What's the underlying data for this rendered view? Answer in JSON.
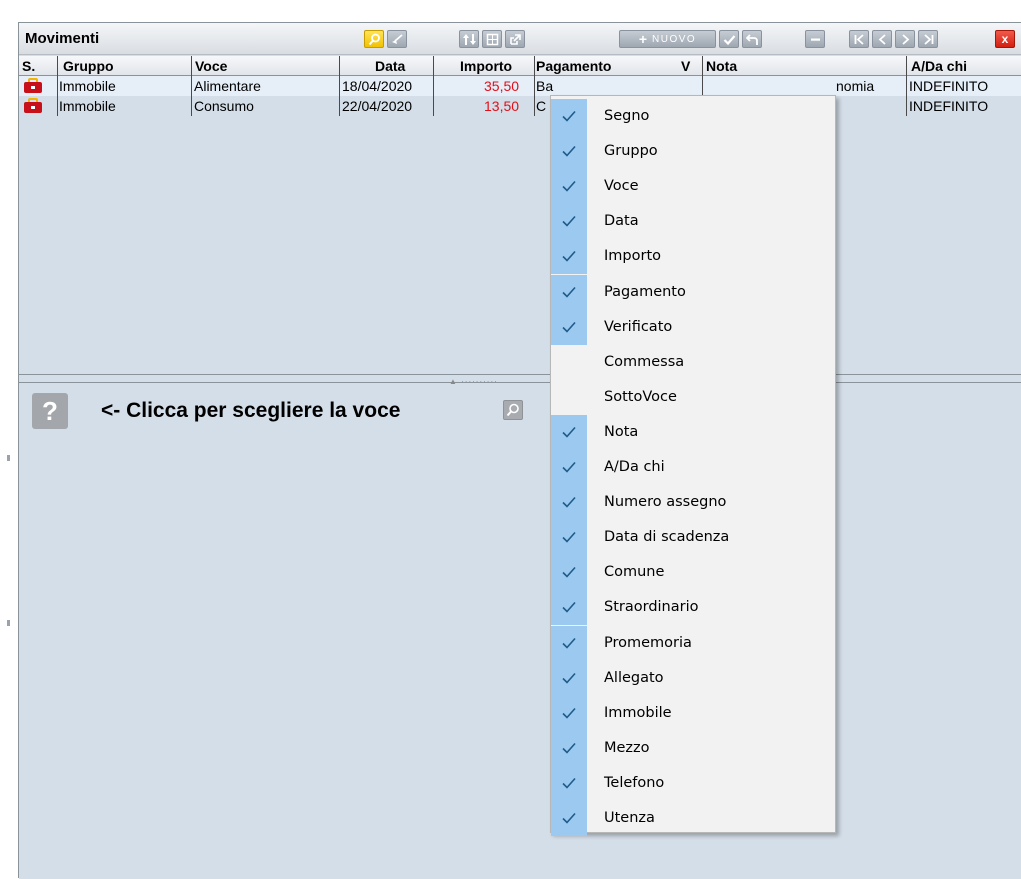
{
  "window": {
    "title": "Movimenti"
  },
  "toolbar": {
    "nuovo_label": "NUOVO",
    "close_label": "x"
  },
  "table": {
    "headers": [
      "S.",
      "Gruppo",
      "Voce",
      "Data",
      "Importo",
      "Pagamento",
      "V",
      "Nota",
      "A/Da chi"
    ],
    "rows": [
      {
        "icon": "red-briefcase-icon",
        "gruppo": "Immobile",
        "voce": "Alimentare",
        "data": "18/04/2020",
        "importo": "35,50",
        "pagamento": "Ba",
        "nota_end": "nomia",
        "a_da_chi": "INDEFINITO"
      },
      {
        "icon": "red-briefcase-icon",
        "gruppo": "Immobile",
        "voce": "Consumo",
        "data": "22/04/2020",
        "importo": "13,50",
        "pagamento": "C",
        "nota_end": "",
        "a_da_chi": "INDEFINITO"
      }
    ]
  },
  "lower": {
    "help_symbol": "?",
    "hint": "<- Clicca per scegliere la voce"
  },
  "context_menu": {
    "items": [
      {
        "label": "Segno",
        "checked": true
      },
      {
        "label": "Gruppo",
        "checked": true
      },
      {
        "label": "Voce",
        "checked": true
      },
      {
        "label": "Data",
        "checked": true
      },
      {
        "label": "Importo",
        "checked": true
      },
      {
        "label": "Pagamento",
        "checked": true
      },
      {
        "label": "Verificato",
        "checked": true
      },
      {
        "label": "Commessa",
        "checked": false
      },
      {
        "label": "SottoVoce",
        "checked": false
      },
      {
        "label": "Nota",
        "checked": true
      },
      {
        "label": "A/Da chi",
        "checked": true
      },
      {
        "label": "Numero assegno",
        "checked": true
      },
      {
        "label": "Data di scadenza",
        "checked": true
      },
      {
        "label": "Comune",
        "checked": true
      },
      {
        "label": "Straordinario",
        "checked": true
      },
      {
        "label": "Promemoria",
        "checked": true
      },
      {
        "label": "Allegato",
        "checked": true
      },
      {
        "label": "Immobile",
        "checked": true
      },
      {
        "label": "Mezzo",
        "checked": true
      },
      {
        "label": "Telefono",
        "checked": true
      },
      {
        "label": "Utenza",
        "checked": true
      }
    ]
  },
  "colors": {
    "panel_bg": "#d4dee8",
    "amount_red": "#e0101a",
    "check_bg": "#9bc9f0",
    "menu_bg": "#f2f2f2"
  }
}
